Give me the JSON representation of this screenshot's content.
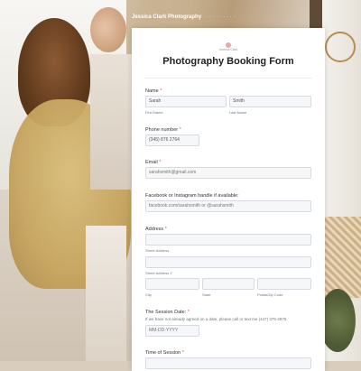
{
  "header": {
    "brand": "Jessica Clark Photography",
    "dots": "· · · · · · · · ·"
  },
  "form": {
    "logo_text": "Jessica Clark",
    "title": "Photography Booking Form",
    "name": {
      "label": "Name",
      "required": "*",
      "first_value": "Sarah",
      "last_value": "Smith",
      "first_sub": "First Name",
      "last_sub": "Last Name"
    },
    "phone": {
      "label": "Phone number",
      "required": "*",
      "value": "(345) 876 2764"
    },
    "email": {
      "label": "Email",
      "required": "*",
      "value": "sarahsmith@gmail.com"
    },
    "social": {
      "label": "Facebook or Instagram handle if available:",
      "value": "facebook.com/sarahsmith or @sarahsmith"
    },
    "address": {
      "label": "Address",
      "required": "*",
      "street": "Street Address",
      "street2": "Street Address 2",
      "city": "City",
      "state": "State",
      "postal": "Postal/Zip Code"
    },
    "session_date": {
      "label": "The Session Date:",
      "required": "*",
      "hint": "If we have not already agreed on a date, please call or text me (447) 375-2975",
      "placeholder": "MM-DD-YYYY"
    },
    "session_time": {
      "label": "Time of Session",
      "required": "*"
    }
  }
}
